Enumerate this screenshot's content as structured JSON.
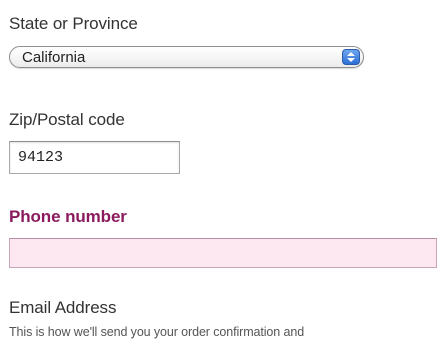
{
  "state_field": {
    "label": "State or Province",
    "selected_value": "California"
  },
  "zip_field": {
    "label": "Zip/Postal code",
    "value": "94123"
  },
  "phone_field": {
    "label": "Phone number",
    "value": "",
    "required_color": "#8b1a5e",
    "background_color": "#fde8f1"
  },
  "email_field": {
    "label": "Email Address",
    "helper_text": "This is how we'll send you your order confirmation and"
  },
  "icons": {
    "select_arrows": "up-down-arrows-icon"
  }
}
